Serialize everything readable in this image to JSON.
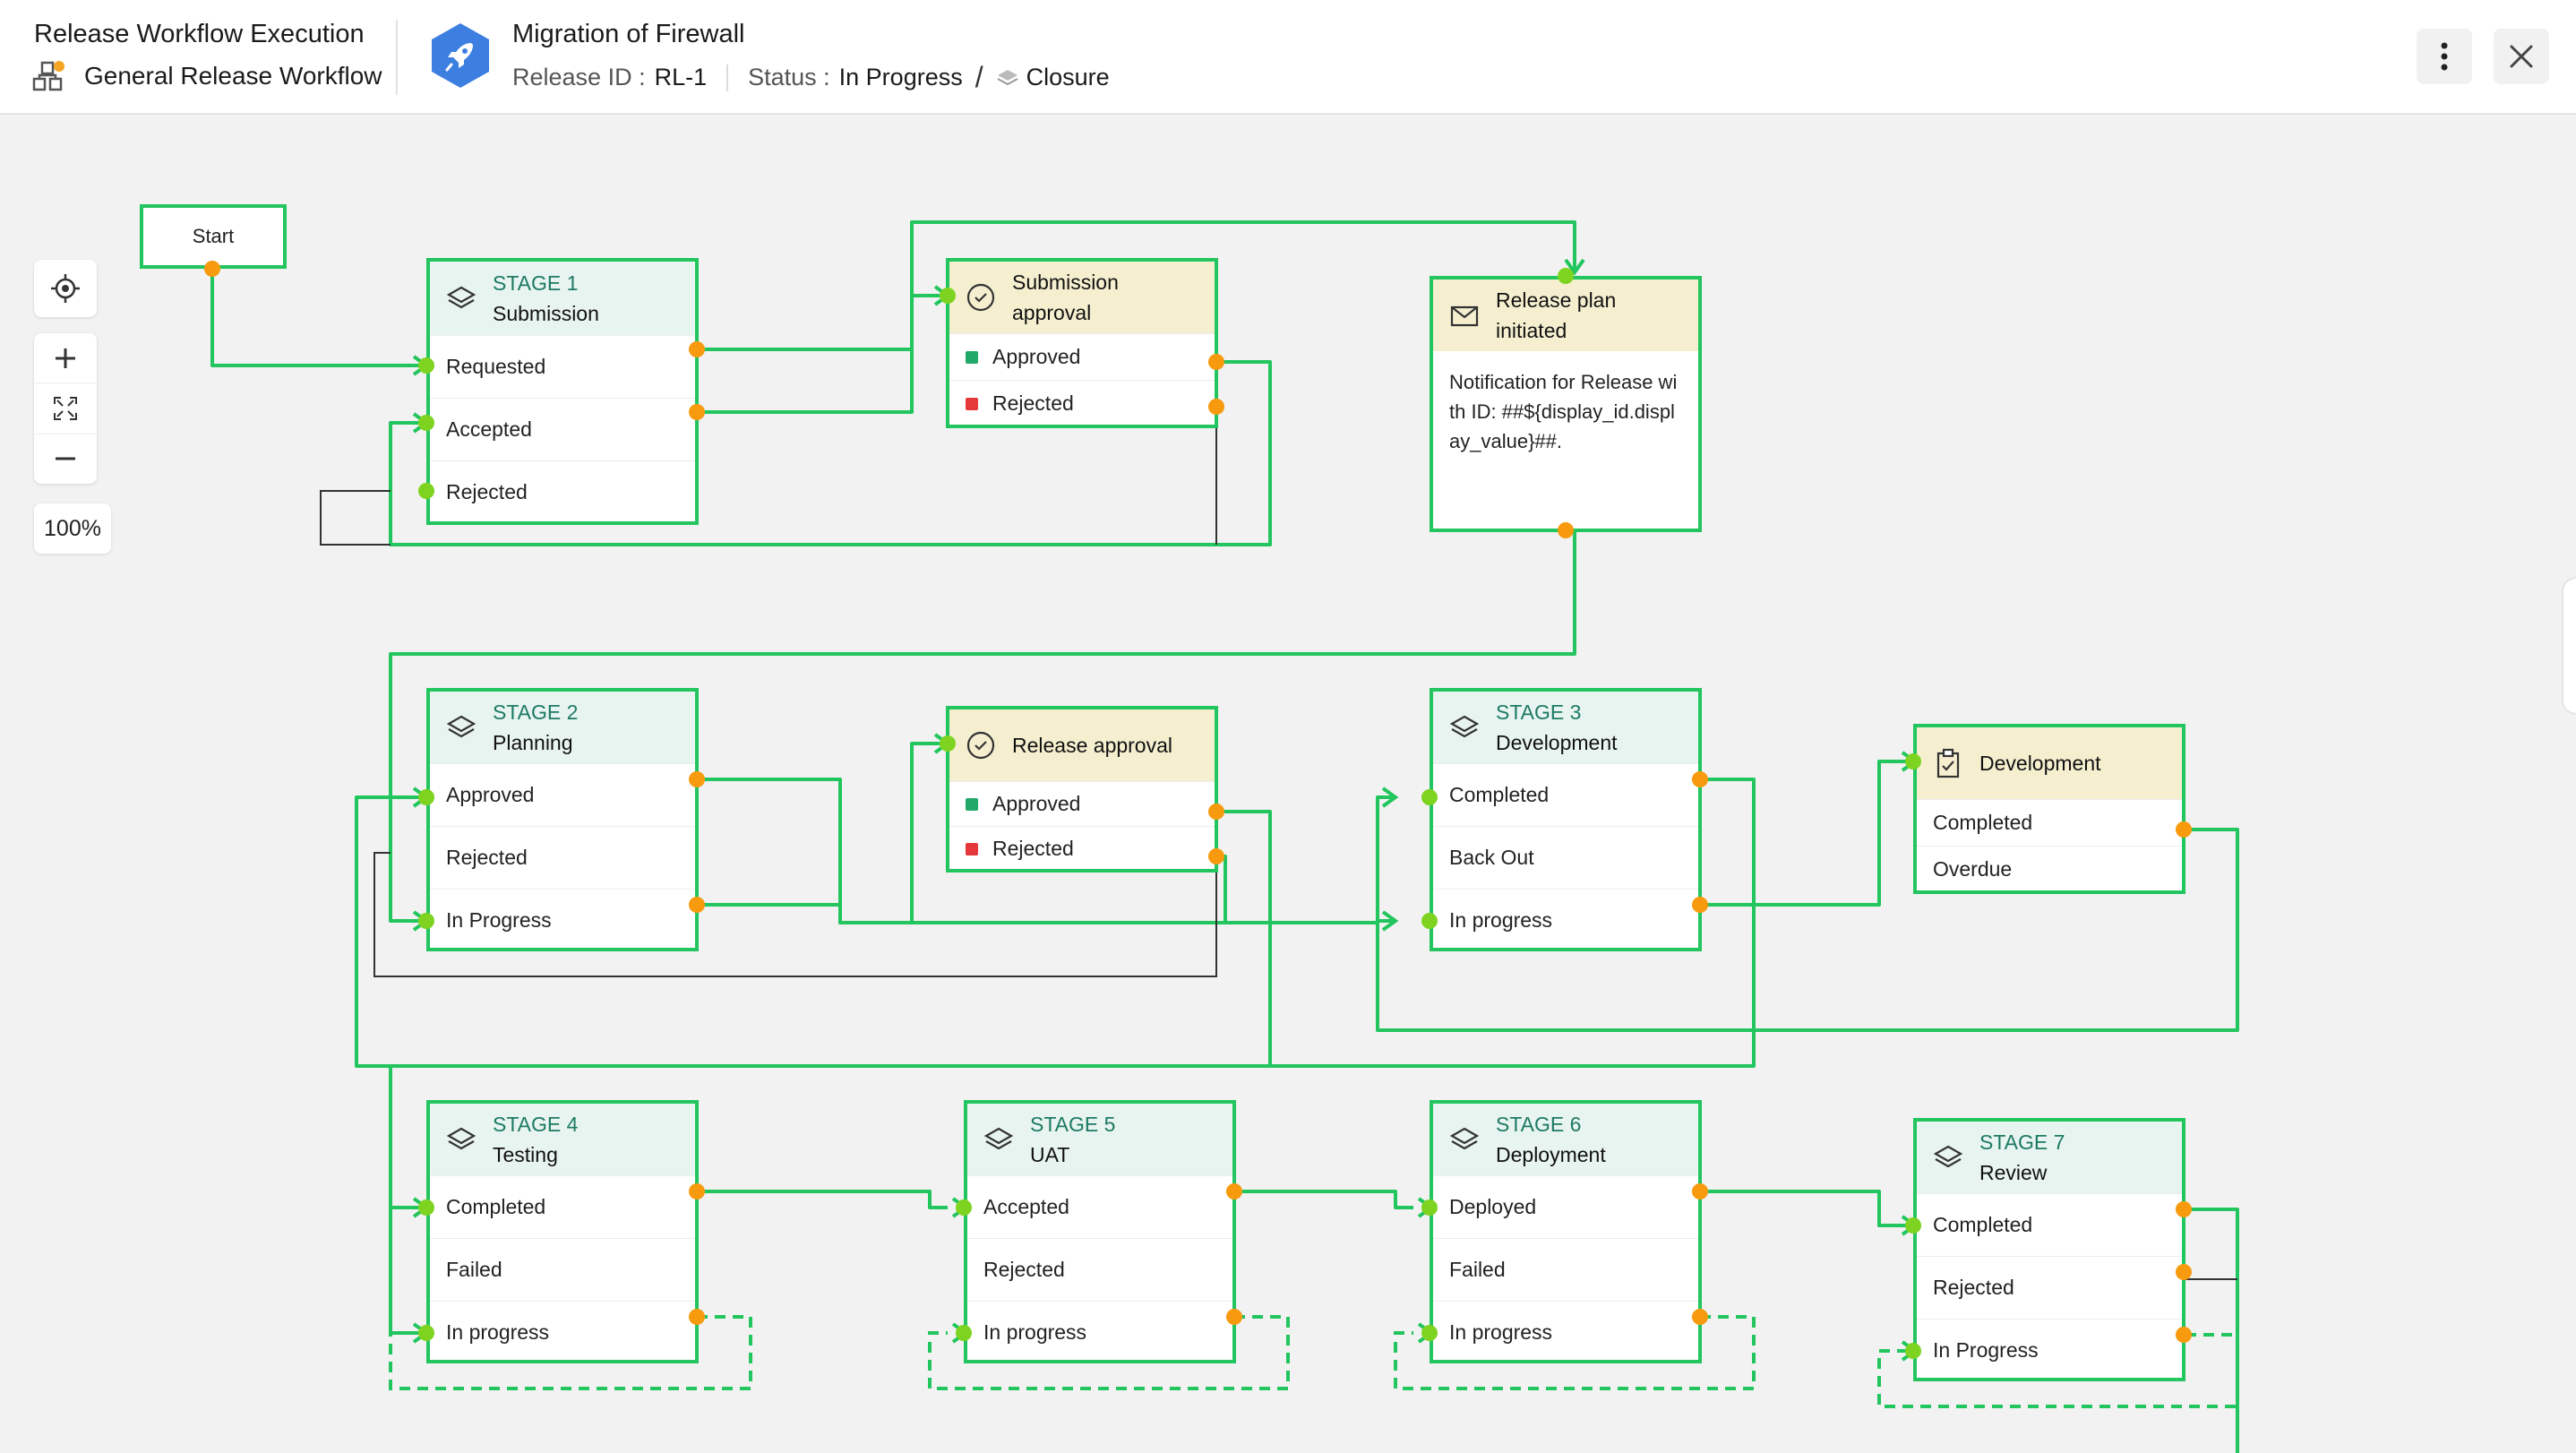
{
  "header": {
    "title": "Release Workflow Execution",
    "workflow_name": "General Release Workflow",
    "release_name": "Migration of Firewall",
    "release_id_label": "Release ID :",
    "release_id": "RL-1",
    "status_label": "Status :",
    "status": "In Progress",
    "separator": "/",
    "next_status": "Closure",
    "icons": [
      "workflow-icon",
      "rocket-icon",
      "more-options-icon",
      "close-icon",
      "layers-icon"
    ]
  },
  "tools": {
    "zoom_level": "100%",
    "icons": [
      "locate-icon",
      "zoom-in-icon",
      "fit-screen-icon",
      "zoom-out-icon"
    ]
  },
  "colors": {
    "edge": "#22c55e",
    "dot_out": "#f79a0e",
    "dot_in": "#7ed321",
    "approved": "#22a869",
    "rejected": "#e5383b",
    "stage_header": "#e8f4ef",
    "approval_header": "#f5efd0"
  },
  "nodes": {
    "start": {
      "label": "Start"
    },
    "stage1": {
      "no": "STAGE 1",
      "name": "Submission",
      "rows": [
        "Requested",
        "Accepted",
        "Rejected"
      ]
    },
    "sub_approval": {
      "name": "Submission approval",
      "rows": [
        "Approved",
        "Rejected"
      ]
    },
    "release_plan": {
      "name": "Release plan initiated",
      "body": "Notification for Release with ID: ##${display_id.display_value}##."
    },
    "stage2": {
      "no": "STAGE 2",
      "name": "Planning",
      "rows": [
        "Approved",
        "Rejected",
        "In Progress"
      ]
    },
    "rel_approval": {
      "name": "Release approval",
      "rows": [
        "Approved",
        "Rejected"
      ]
    },
    "stage3": {
      "no": "STAGE 3",
      "name": "Development",
      "rows": [
        "Completed",
        "Back Out",
        "In progress"
      ]
    },
    "development": {
      "name": "Development",
      "rows": [
        "Completed",
        "Overdue"
      ]
    },
    "stage4": {
      "no": "STAGE 4",
      "name": "Testing",
      "rows": [
        "Completed",
        "Failed",
        "In progress"
      ]
    },
    "stage5": {
      "no": "STAGE 5",
      "name": "UAT",
      "rows": [
        "Accepted",
        "Rejected",
        "In progress"
      ]
    },
    "stage6": {
      "no": "STAGE 6",
      "name": "Deployment",
      "rows": [
        "Deployed",
        "Failed",
        "In progress"
      ]
    },
    "stage7": {
      "no": "STAGE 7",
      "name": "Review",
      "rows": [
        "Completed",
        "Rejected",
        "In Progress"
      ]
    }
  }
}
